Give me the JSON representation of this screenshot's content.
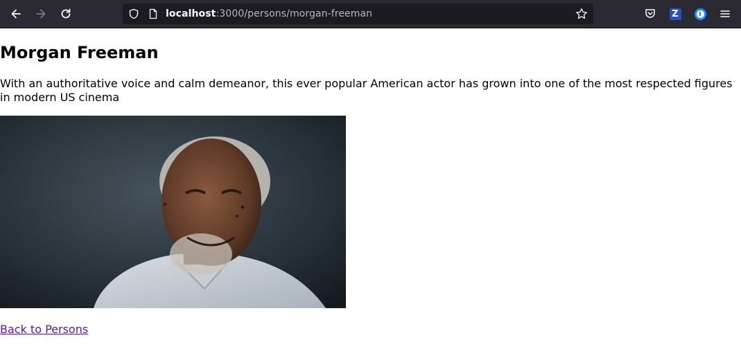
{
  "browser": {
    "url_host": "localhost",
    "url_path": ":3000/persons/morgan-freeman",
    "extensions": {
      "zotero_label": "Z",
      "onepassword_label": "①"
    }
  },
  "page": {
    "title": "Morgan Freeman",
    "description": "With an authoritative voice and calm demeanor, this ever popular American actor has grown into one of the most respected figures in modern US cinema",
    "back_link_label": "Back to Persons"
  },
  "colors": {
    "toolbar_bg": "#2b2a33",
    "urlbar_bg": "#1c1b22",
    "link_visited": "#551a8b"
  }
}
